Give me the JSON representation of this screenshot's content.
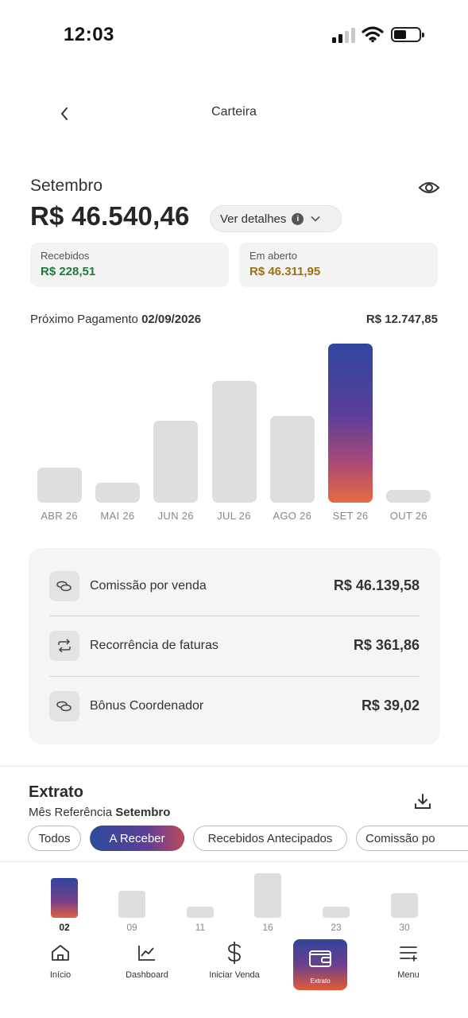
{
  "status_bar": {
    "time": "12:03"
  },
  "header": {
    "title": "Carteira"
  },
  "summary": {
    "month": "Setembro",
    "balance": "R$ 46.540,46",
    "details_label": "Ver detalhes",
    "received_label": "Recebidos",
    "received_value": "R$ 228,51",
    "open_label": "Em aberto",
    "open_value": "R$ 46.311,95"
  },
  "next_payment": {
    "label": "Próximo Pagamento",
    "date": "02/09/2026",
    "amount": "R$ 12.747,85"
  },
  "chart_data": {
    "type": "bar",
    "categories": [
      "ABR 26",
      "MAI 26",
      "JUN 26",
      "JUL 26",
      "AGO 26",
      "SET 26",
      "OUT 26"
    ],
    "values": [
      8.5,
      4.8,
      19.8,
      29.5,
      21.0,
      38.5,
      3.0
    ],
    "highlighted": "SET 26",
    "title": "",
    "xlabel": "",
    "ylabel": ""
  },
  "commissions": {
    "items": [
      {
        "name": "Comissão por venda",
        "amount": "R$ 46.139,58",
        "icon": "coins-icon"
      },
      {
        "name": "Recorrência de faturas",
        "amount": "R$ 361,86",
        "icon": "repeat-icon"
      },
      {
        "name": "Bônus Coordenador",
        "amount": "R$ 39,02",
        "icon": "coins-icon"
      }
    ]
  },
  "extrato": {
    "title": "Extrato",
    "ref_label": "Mês Referência",
    "ref_month": "Setembro",
    "filters": [
      "Todos",
      "A Receber",
      "Recebidos Antecipados",
      "Comissão po"
    ],
    "active_filter": "A Receber"
  },
  "daily_chart": {
    "days": [
      "02",
      "09",
      "11",
      "16",
      "23",
      "30"
    ],
    "levels": [
      0.9,
      0.6,
      0.25,
      1.0,
      0.25,
      0.55
    ],
    "selected": "02"
  },
  "tab_bar": {
    "items": [
      {
        "label": "Início",
        "icon": "home-icon"
      },
      {
        "label": "Dashboard",
        "icon": "chart-line-icon"
      },
      {
        "label": "Iniciar Venda",
        "icon": "dollar-icon"
      },
      {
        "label": "Extrato",
        "icon": "wallet-icon"
      },
      {
        "label": "Menu",
        "icon": "menu-icon"
      }
    ],
    "active": "Extrato"
  },
  "colors": {
    "received": "#1e7a3c",
    "open": "#9a7212",
    "gradient_start": "#2f469e",
    "gradient_end": "#e66b42"
  }
}
